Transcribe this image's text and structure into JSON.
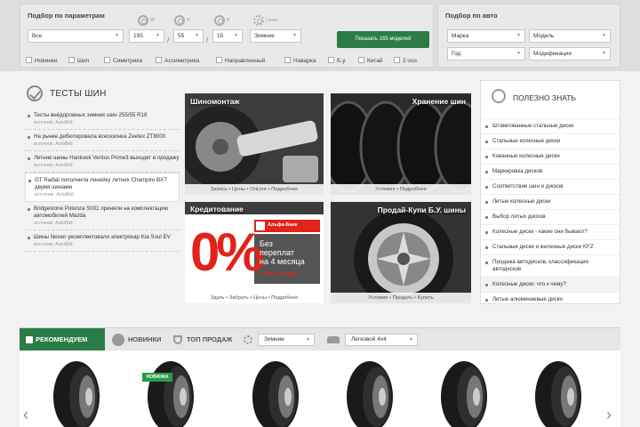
{
  "filters": {
    "params_title": "Подбор  по параметрам",
    "auto_title": "Подбор  по авто",
    "season_label": "Сезон",
    "season_value": "Зимние",
    "dims": [
      "W",
      "H",
      "R"
    ],
    "brand_value": "Все",
    "width_value": "195",
    "profile_value": "55",
    "radius_value": "15",
    "show_button": "Показать 165 моделей",
    "checkboxes": [
      "Новинки",
      "Шип",
      "Симетрика",
      "Ассиметрика",
      "Направленный",
      "Наварка",
      "Б.у.",
      "Китай",
      "2 оси"
    ],
    "auto": {
      "brand": "Марка",
      "model": "Модель",
      "year": "Год",
      "mod": "Модификация"
    }
  },
  "tests": {
    "title": "ТЕСТЫ ШИН",
    "items": [
      {
        "title": "Тесты внедорожных зимних шин 255/55 R18",
        "source": "источник: AutoBild"
      },
      {
        "title": "На рынке дебютировала всесезонка Zeetex ZT8000",
        "source": "источник: AutoBild"
      },
      {
        "title": "Летние шины Hankook Ventus Prime3 выходят в продажу",
        "source": "источник: AutoBild"
      },
      {
        "title": "GT Radial пополнила линейку летних Champiro BXT двумя шинами",
        "source": "источник: AutoBild"
      },
      {
        "title": "Bridgestone Potenza S001 приняли на комплектацию автомобилей Mazda",
        "source": "источник: AutoBild"
      },
      {
        "title": "Шины Nexen укомплектовали электрокар Kia Soul EV",
        "source": "источник: AutoBild"
      }
    ]
  },
  "tiles": {
    "service": {
      "title": "Шиномонтаж",
      "foot": "Запись • Цены • OnLine • Подробнее"
    },
    "storage": {
      "title": "Хранение шин",
      "foot": "Условия • Подробнее"
    },
    "credit": {
      "title": "Кредитование",
      "foot": "Здать • Забрать • Цены • Подробнее",
      "percent": "0%",
      "bank": "Альфа-Банк",
      "offer": [
        "Без",
        "переплат",
        "на 4 месяца"
      ],
      "tagline": "на все товары"
    },
    "used": {
      "title": "Продай-Купи Б.У. шины",
      "foot": "Условия • Продать • Купить"
    }
  },
  "useful": {
    "title": "ПОЛЕЗНО ЗНАТЬ",
    "items": [
      "Штампованные стальные диски",
      "Стальные колесные диски",
      "Кованные колесные диски",
      "Маркировка дисков",
      "Соответствие шин и дисков",
      "Литые колесные диски",
      "Выбор литых дисков",
      "Колесные диски - какие они бывают?",
      "Стальные диски и железные диски KFZ",
      "Продажа автодисков, классификация автодисков",
      "Колесные диски: что к чему?",
      "Литые алюминиевые диски"
    ]
  },
  "tabs": {
    "recommend": "РЕКОМЕНДУЕМ",
    "new": "НОВИНКИ",
    "top": "ТОП ПРОДАЖ",
    "season": "Зимние",
    "car": "Легковой 4х4"
  },
  "products": {
    "badge": "НОВИНКА",
    "arrow_left": "‹",
    "arrow_right": "›"
  },
  "colors": {
    "accent": "#2b7c46",
    "credit_red": "#e2231a",
    "panel": "#e9e9e9"
  }
}
